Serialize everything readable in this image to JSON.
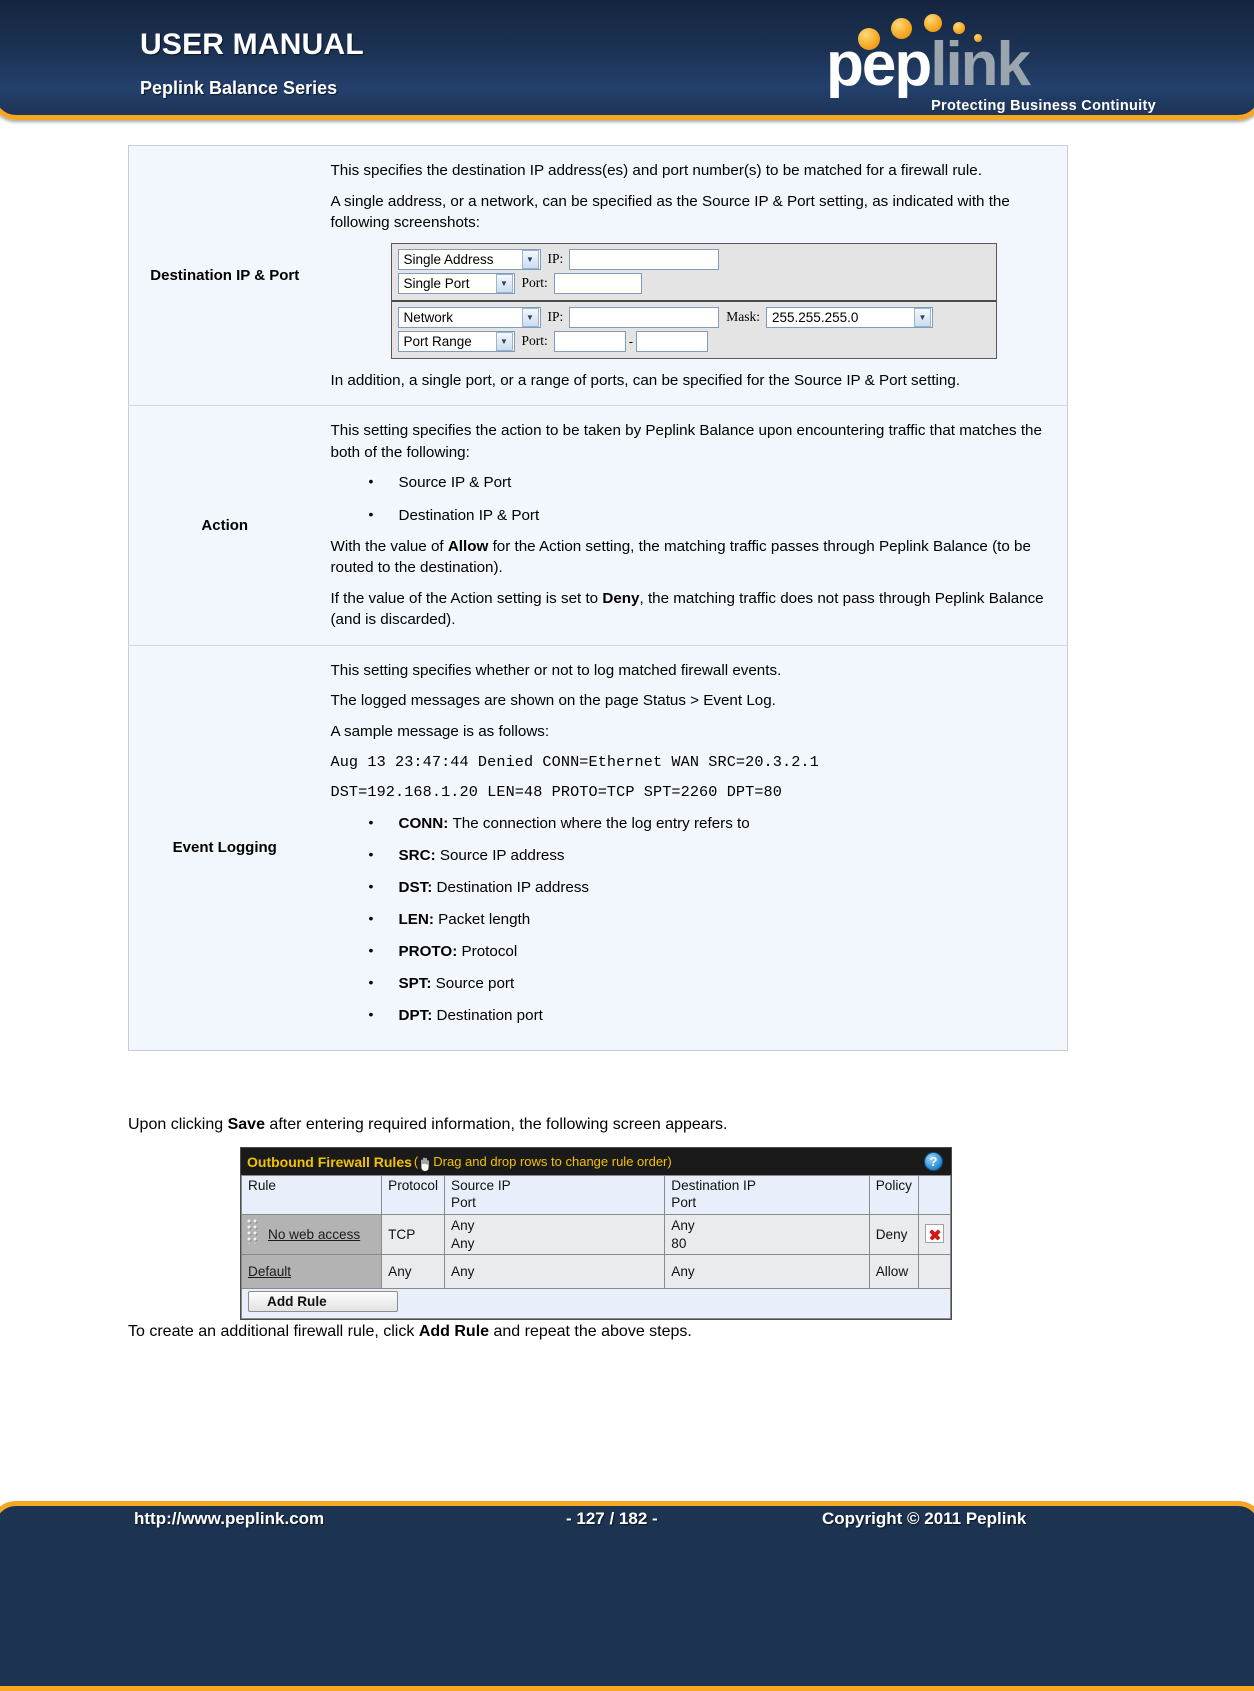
{
  "header": {
    "title": "USER MANUAL",
    "subtitle": "Peplink Balance Series",
    "logo": {
      "word_part1": "pep",
      "word_part2": "link",
      "tagline": "Protecting Business Continuity"
    }
  },
  "param_table": {
    "rows": [
      {
        "label": "Destination IP & Port",
        "paragraphs_before": [
          "This specifies the destination IP address(es) and port number(s) to be matched for a firewall rule.",
          "A single address, or a network, can be specified as the Source IP & Port setting, as indicated with the following screenshots:"
        ],
        "paragraphs_after": [
          "In addition, a single port, or a range of ports, can be specified for the Source IP & Port setting."
        ],
        "ipform": {
          "group1": {
            "row1": {
              "select": "Single Address",
              "label": "IP:",
              "value": ""
            },
            "row2": {
              "select": "Single Port",
              "label": "Port:",
              "value": ""
            }
          },
          "group2": {
            "row1": {
              "select": "Network",
              "label": "IP:",
              "value": "",
              "mask_label": "Mask:",
              "mask_value": "255.255.255.0"
            },
            "row2": {
              "select": "Port Range",
              "label": "Port:",
              "from": "",
              "separator": "-",
              "to": ""
            }
          }
        }
      },
      {
        "label": "Action",
        "intro": "This setting specifies the action to be taken by Peplink Balance upon encountering traffic that matches the both of the following:",
        "bullets": [
          "Source IP & Port",
          "Destination IP & Port"
        ],
        "allow_sentence_1": "With the value of ",
        "allow_bold": "Allow",
        "allow_sentence_2": " for the Action setting, the matching traffic passes through Peplink Balance (to be routed to the destination).",
        "deny_sentence_1": "If the value of the Action setting is set to ",
        "deny_bold": "Deny",
        "deny_sentence_2": ", the matching traffic does not pass through Peplink Balance (and is discarded)."
      },
      {
        "label": "Event Logging",
        "paragraphs": [
          "This setting specifies whether or not to log matched firewall events.",
          "The logged messages are shown on the page Status > Event Log.",
          "A sample message is as follows:"
        ],
        "log_lines": [
          "Aug 13 23:47:44 Denied CONN=Ethernet WAN SRC=20.3.2.1",
          "DST=192.168.1.20 LEN=48 PROTO=TCP SPT=2260 DPT=80"
        ],
        "fields": [
          {
            "key": "CONN:",
            "desc": "The connection where the log entry refers to"
          },
          {
            "key": "SRC:",
            "desc": "Source IP address"
          },
          {
            "key": "DST:",
            "desc": "Destination IP address"
          },
          {
            "key": "LEN:",
            "desc": "Packet length"
          },
          {
            "key": "PROTO:",
            "desc": "Protocol"
          },
          {
            "key": "SPT:",
            "desc": "Source port"
          },
          {
            "key": "DPT:",
            "desc": "Destination port"
          }
        ]
      }
    ]
  },
  "body": {
    "save_para_1": "Upon clicking ",
    "save_bold": "Save",
    "save_para_2": " after entering required information, the following screen appears.",
    "addrule_para_1": "To create an additional firewall rule, click ",
    "addrule_bold": "Add Rule",
    "addrule_para_2": " and repeat the above steps."
  },
  "firewall_panel": {
    "title": "Outbound Firewall Rules",
    "hint_open": "(",
    "hint": "Drag and drop rows to change rule order)",
    "help_glyph": "?",
    "columns": [
      "Rule",
      "Protocol",
      "Source IP\nPort",
      "Destination IP\nPort",
      "Policy",
      ""
    ],
    "col_rule": "Rule",
    "col_protocol": "Protocol",
    "col_src_line1": "Source IP",
    "col_src_line2": "Port",
    "col_dst_line1": "Destination IP",
    "col_dst_line2": "Port",
    "col_policy": "Policy",
    "rows": [
      {
        "rule": "No web access",
        "protocol": "TCP",
        "src_ip": "Any",
        "src_port": "Any",
        "dst_ip": "Any",
        "dst_port": "80",
        "policy": "Deny",
        "has_delete": true
      },
      {
        "rule": "Default",
        "protocol": "Any",
        "src_ip": "Any",
        "src_port": "",
        "dst_ip": "Any",
        "dst_port": "",
        "policy": "Allow",
        "has_delete": false
      }
    ],
    "add_button": "Add Rule"
  },
  "footer": {
    "url": "http://www.peplink.com",
    "page": "- 127 / 182 -",
    "copyright": "Copyright © 2011 Peplink"
  },
  "colors": {
    "brand_orange": "#f5a623",
    "header_navy": "#1b3152",
    "table_bg": "#f2f6fd",
    "panel_title_yellow": "#f2c200"
  }
}
